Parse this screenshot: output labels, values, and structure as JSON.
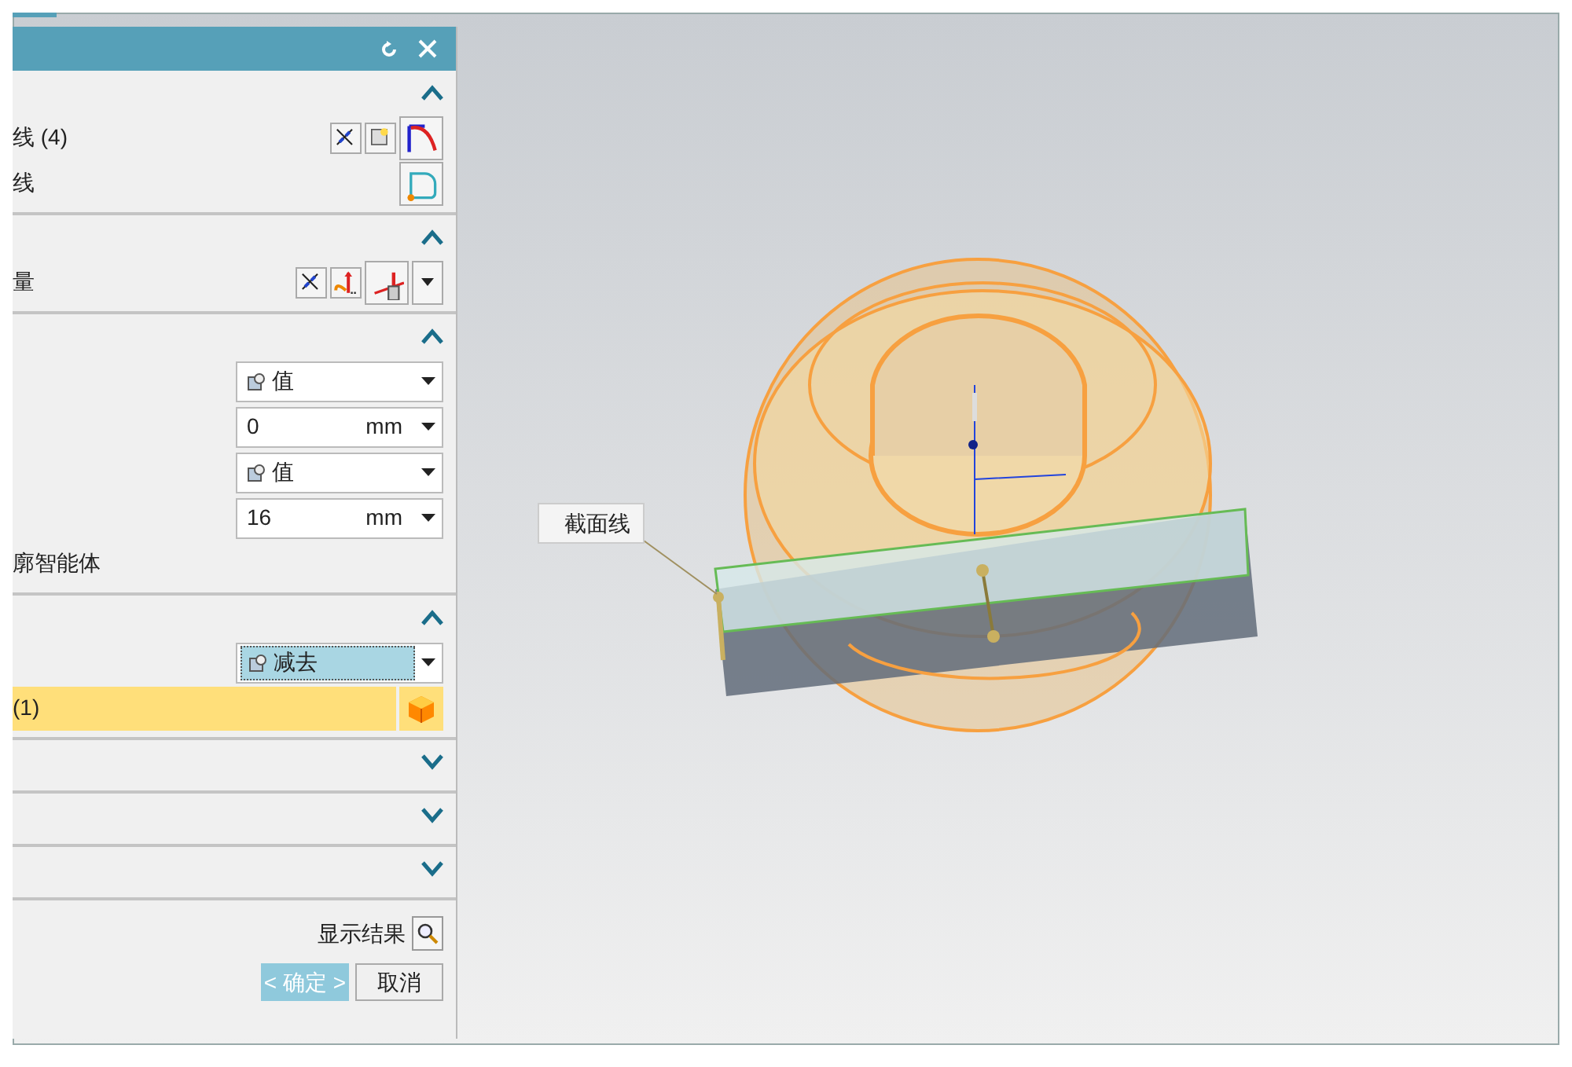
{
  "dialog": {
    "sections": [
      {
        "expanded": true,
        "rows": [
          {
            "kind": "text-icons",
            "label": "线 (4)",
            "tools": [
              {
                "kind": "cross"
              },
              {
                "kind": "select"
              },
              {
                "kind": "curve"
              }
            ]
          },
          {
            "kind": "text-icons",
            "label": "线",
            "tools": [
              {
                "kind": "corner"
              }
            ]
          }
        ]
      },
      {
        "expanded": true,
        "rows": [
          {
            "kind": "text-icons",
            "label": "量",
            "tools": [
              {
                "kind": "cross"
              },
              {
                "kind": "axis"
              },
              {
                "kind": "vector"
              }
            ],
            "menu": true
          }
        ]
      },
      {
        "expanded": true,
        "rows": [
          {
            "kind": "dropdown",
            "value": "值",
            "icon": true
          },
          {
            "kind": "number",
            "value": "0",
            "unit": "mm"
          },
          {
            "kind": "dropdown",
            "value": "值",
            "icon": true
          },
          {
            "kind": "number",
            "value": "16",
            "unit": "mm"
          },
          {
            "kind": "label",
            "label": "廓智能体"
          }
        ]
      },
      {
        "expanded": true,
        "rows": [
          {
            "kind": "dropdown",
            "value": "减去",
            "icon": true,
            "selected": true
          },
          {
            "kind": "selection",
            "label": "(1)",
            "selected": true
          }
        ]
      },
      {
        "expanded": false
      },
      {
        "expanded": false
      },
      {
        "expanded": false
      }
    ],
    "preview_label": "显示结果",
    "ok": "< 确定 >",
    "cancel": "取消"
  },
  "viewport": {
    "callout": "截面线"
  }
}
